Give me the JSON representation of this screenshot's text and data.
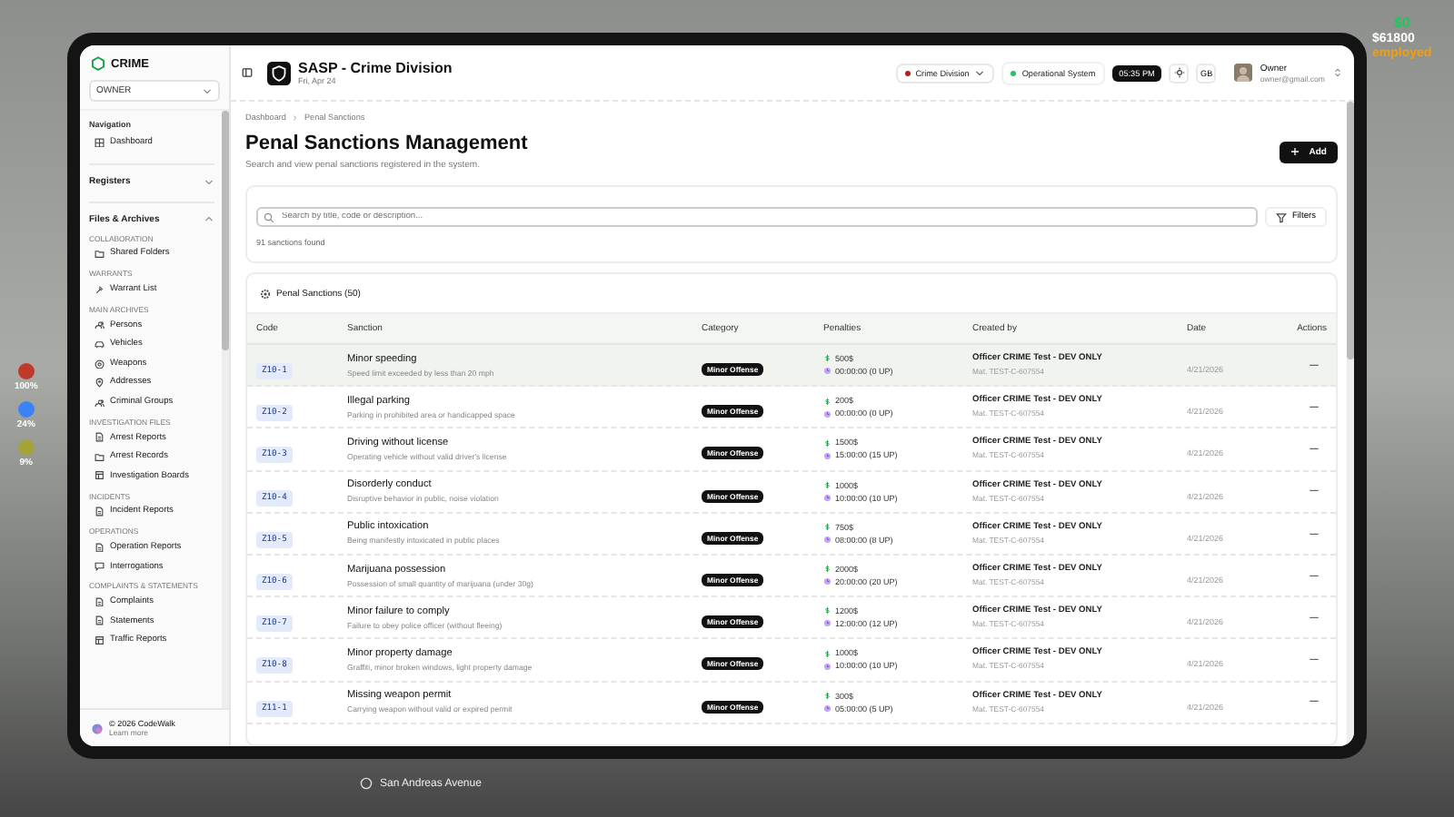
{
  "hud": {
    "cash": "$0",
    "bank": "$61800",
    "job": "employed",
    "stats": [
      "100%",
      "24%",
      "9%"
    ],
    "street": "San Andreas Avenue"
  },
  "sidebar": {
    "brand": "CRIME",
    "role": "OWNER",
    "nav_label": "Navigation",
    "dashboard": "Dashboard",
    "groups": [
      {
        "label": "Registers",
        "expanded": false
      },
      {
        "label": "Files & Archives",
        "expanded": true,
        "sections": [
          {
            "title": "COLLABORATION",
            "items": [
              {
                "label": "Shared Folders",
                "kind": "folder"
              }
            ]
          },
          {
            "title": "WARRANTS",
            "items": [
              {
                "label": "Warrant List",
                "kind": "hammer"
              }
            ]
          },
          {
            "title": "MAIN ARCHIVES",
            "items": [
              {
                "label": "Persons",
                "kind": "users"
              },
              {
                "label": "Vehicles",
                "kind": "car"
              },
              {
                "label": "Weapons",
                "kind": "target"
              },
              {
                "label": "Addresses",
                "kind": "pin"
              },
              {
                "label": "Criminal Groups",
                "kind": "users"
              }
            ]
          },
          {
            "title": "INVESTIGATION FILES",
            "items": [
              {
                "label": "Arrest Reports",
                "kind": "doc"
              },
              {
                "label": "Arrest Records",
                "kind": "folder"
              },
              {
                "label": "Investigation Boards",
                "kind": "board"
              }
            ]
          },
          {
            "title": "INCIDENTS",
            "items": [
              {
                "label": "Incident Reports",
                "kind": "doc"
              }
            ]
          },
          {
            "title": "OPERATIONS",
            "items": [
              {
                "label": "Operation Reports",
                "kind": "doc"
              },
              {
                "label": "Interrogations",
                "kind": "chat"
              }
            ]
          },
          {
            "title": "COMPLAINTS & STATEMENTS",
            "items": [
              {
                "label": "Complaints",
                "kind": "doc"
              },
              {
                "label": "Statements",
                "kind": "doc"
              },
              {
                "label": "Traffic Reports",
                "kind": "board"
              }
            ]
          }
        ]
      }
    ],
    "footer": {
      "copyright": "© 2026 CodeWalk",
      "link": "Learn more"
    }
  },
  "header": {
    "title": "SASP - Crime Division",
    "date": "Fri, Apr 24",
    "division": "Crime Division",
    "status": "Operational System",
    "time": "05:35 PM",
    "lang": "GB",
    "user_name": "Owner",
    "user_email": "owner@gmail.com"
  },
  "breadcrumb": [
    "Dashboard",
    "Penal Sanctions"
  ],
  "page": {
    "title": "Penal Sanctions Management",
    "subtitle": "Search and view penal sanctions registered in the system.",
    "add_button": "Add"
  },
  "search": {
    "placeholder": "Search by title, code or description...",
    "filters": "Filters",
    "count": "91 sanctions found"
  },
  "table": {
    "title": "Penal Sanctions (50)",
    "columns": [
      "Code",
      "Sanction",
      "Category",
      "Penalties",
      "Created by",
      "Date",
      "Actions"
    ],
    "rows": [
      {
        "code": "Z10-1",
        "title": "Minor speeding",
        "desc": "Speed limit exceeded by less than 20 mph",
        "category": "Minor Offense",
        "fine": "500$",
        "time": "00:00:00 (0 UP)",
        "officer": "Officer CRIME Test - DEV ONLY",
        "mat": "Mat. TEST-C-607554",
        "date": "4/21/2026",
        "selected": true
      },
      {
        "code": "Z10-2",
        "title": "Illegal parking",
        "desc": "Parking in prohibited area or handicapped space",
        "category": "Minor Offense",
        "fine": "200$",
        "time": "00:00:00 (0 UP)",
        "officer": "Officer CRIME Test - DEV ONLY",
        "mat": "Mat. TEST-C-607554",
        "date": "4/21/2026",
        "selected": false
      },
      {
        "code": "Z10-3",
        "title": "Driving without license",
        "desc": "Operating vehicle without valid driver's license",
        "category": "Minor Offense",
        "fine": "1500$",
        "time": "15:00:00 (15 UP)",
        "officer": "Officer CRIME Test - DEV ONLY",
        "mat": "Mat. TEST-C-607554",
        "date": "4/21/2026",
        "selected": false
      },
      {
        "code": "Z10-4",
        "title": "Disorderly conduct",
        "desc": "Disruptive behavior in public, noise violation",
        "category": "Minor Offense",
        "fine": "1000$",
        "time": "10:00:00 (10 UP)",
        "officer": "Officer CRIME Test - DEV ONLY",
        "mat": "Mat. TEST-C-607554",
        "date": "4/21/2026",
        "selected": false
      },
      {
        "code": "Z10-5",
        "title": "Public intoxication",
        "desc": "Being manifestly intoxicated in public places",
        "category": "Minor Offense",
        "fine": "750$",
        "time": "08:00:00 (8 UP)",
        "officer": "Officer CRIME Test - DEV ONLY",
        "mat": "Mat. TEST-C-607554",
        "date": "4/21/2026",
        "selected": false
      },
      {
        "code": "Z10-6",
        "title": "Marijuana possession",
        "desc": "Possession of small quantity of marijuana (under 30g)",
        "category": "Minor Offense",
        "fine": "2000$",
        "time": "20:00:00 (20 UP)",
        "officer": "Officer CRIME Test - DEV ONLY",
        "mat": "Mat. TEST-C-607554",
        "date": "4/21/2026",
        "selected": false
      },
      {
        "code": "Z10-7",
        "title": "Minor failure to comply",
        "desc": "Failure to obey police officer (without fleeing)",
        "category": "Minor Offense",
        "fine": "1200$",
        "time": "12:00:00 (12 UP)",
        "officer": "Officer CRIME Test - DEV ONLY",
        "mat": "Mat. TEST-C-607554",
        "date": "4/21/2026",
        "selected": false
      },
      {
        "code": "Z10-8",
        "title": "Minor property damage",
        "desc": "Graffiti, minor broken windows, light property damage",
        "category": "Minor Offense",
        "fine": "1000$",
        "time": "10:00:00 (10 UP)",
        "officer": "Officer CRIME Test - DEV ONLY",
        "mat": "Mat. TEST-C-607554",
        "date": "4/21/2026",
        "selected": false
      },
      {
        "code": "Z11-1",
        "title": "Missing weapon permit",
        "desc": "Carrying weapon without valid or expired permit",
        "category": "Minor Offense",
        "fine": "300$",
        "time": "05:00:00 (5 UP)",
        "officer": "Officer CRIME Test - DEV ONLY",
        "mat": "Mat. TEST-C-607554",
        "date": "4/21/2026",
        "selected": false
      }
    ]
  }
}
